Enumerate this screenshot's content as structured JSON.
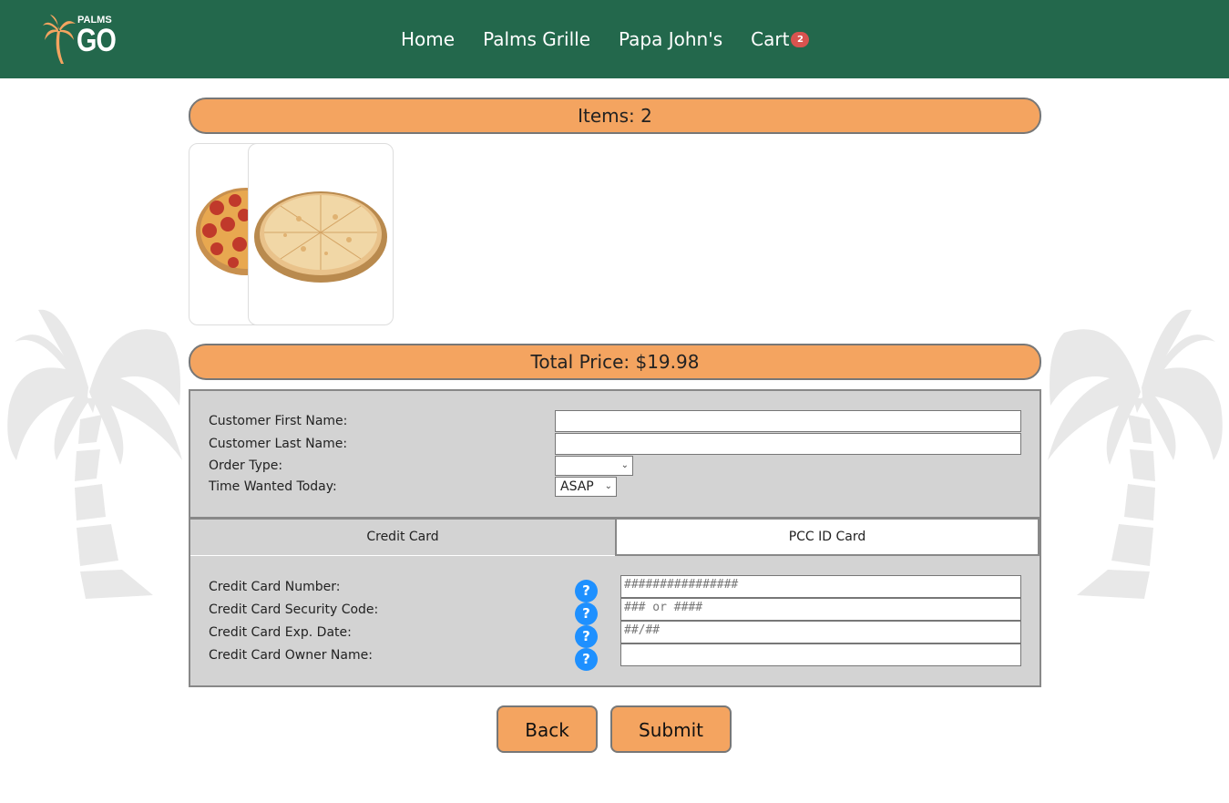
{
  "header": {
    "logo_small": "PALMS",
    "logo_big": "GO",
    "nav": [
      "Home",
      "Palms Grille",
      "Papa John's"
    ],
    "cart_label": "Cart",
    "cart_count": "2"
  },
  "cart": {
    "items_label": "Items: 2",
    "total_label": "Total Price: $19.98",
    "item_images": [
      "pepperoni-pizza",
      "cheese-pizza"
    ]
  },
  "customer_form": {
    "first_name_label": "Customer First Name:",
    "last_name_label": "Customer Last Name:",
    "order_type_label": "Order Type:",
    "order_type_value": "",
    "time_wanted_label": "Time Wanted Today:",
    "time_wanted_value": "ASAP"
  },
  "tabs": {
    "credit_card": "Credit Card",
    "pcc_id_card": "PCC ID Card"
  },
  "credit_card_form": {
    "number_label": "Credit Card Number:",
    "number_placeholder": "################",
    "security_label": "Credit Card Security Code:",
    "security_placeholder": "### or ####",
    "exp_label": "Credit Card Exp. Date:",
    "exp_placeholder": "##/##",
    "owner_label": "Credit Card Owner Name:",
    "help_glyph": "?"
  },
  "actions": {
    "back_label": "Back",
    "submit_label": "Submit"
  },
  "colors": {
    "header_bg": "#23684c",
    "accent_orange": "#f4a460",
    "panel_gray": "#d3d3d3",
    "help_blue": "#1e90ff",
    "badge_red": "#d9534f"
  }
}
